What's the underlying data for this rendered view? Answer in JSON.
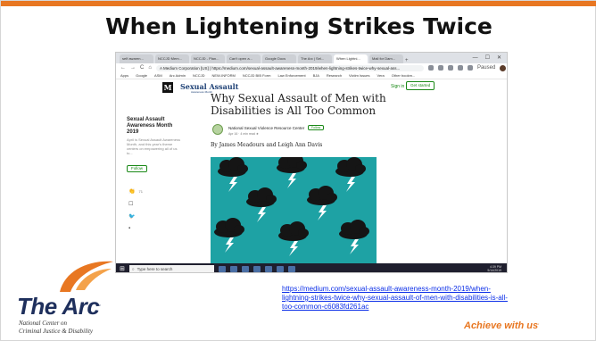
{
  "slide": {
    "title": "When Lightening Strikes Twice",
    "source_link": "https://medium.com/sexual-assault-awareness-month-2019/when-lightning-strikes-twice-why-sexual-assault-of-men-with-disabilities-is-all-too-common-c6083fd261ac",
    "accent_color": "#e87722",
    "link_color": "#0b2ee8"
  },
  "logo": {
    "name": "The Arc",
    "mark": ".",
    "subtitle_line1": "National Center on",
    "subtitle_line2": "Criminal Justice & Disability",
    "brand_color": "#1e2f5c"
  },
  "tagline": {
    "text": "Achieve with us",
    "mark": "."
  },
  "browser": {
    "tabs": [
      "self awaren...",
      "NCCJD Mem...",
      "NCCJD - Plan...",
      "Can't open a...",
      "Google Docs",
      "The Arc | Sel...",
      "When Lightni...",
      "Mail for Dam..."
    ],
    "active_tab_index": 6,
    "new_tab": "+",
    "window_controls": [
      "—",
      "☐",
      "✕"
    ],
    "nav_glyphs": [
      "←",
      "→",
      "C",
      "⌂"
    ],
    "address": "A Medium Corporation [US] | https://medium.com/sexual-assault-awareness-month-2019/when-lightning-strikes-twice-why-sexual-ass...",
    "profile_label": "Paused",
    "bookmarks": [
      "Apps",
      "Google",
      "ASM",
      "Arc Admin",
      "NCCJD",
      "NEW-INFORM",
      "NCCJD BIB Form",
      "Law Enforcement",
      "BJA",
      "Research",
      "Victim Issues",
      "Vera",
      "Other bookm..."
    ]
  },
  "medium": {
    "logo_letter": "M",
    "publication_logo": "Sexual Assault",
    "publication_logo_sub": "Awareness Month",
    "sign_in": "Sign in",
    "get_started": "Get started",
    "sidebar": {
      "publication_name": "Sexual Assault Awareness Month 2019",
      "publication_desc": "April is Sexual Assault Awareness Month, and this year's theme centers on empowering all of us to...",
      "follow": "Follow",
      "clap_count": "71",
      "icons": [
        "clap-icon",
        "bookmark-icon",
        "twitter-icon",
        "facebook-icon"
      ]
    },
    "article": {
      "title": "Why Sexual Assault of Men with Disabilities is All Too Common",
      "author": "National Sexual Violence Resource Center",
      "follow": "Follow",
      "meta": "Apr 16 · 4 min read ★",
      "byline": "By James Meadours and Leigh Ann Davis",
      "hero_color": "#1ea2a4"
    }
  },
  "taskbar": {
    "search_placeholder": "Type here to search",
    "time": "4:39 PM",
    "date": "5/14/2019"
  }
}
